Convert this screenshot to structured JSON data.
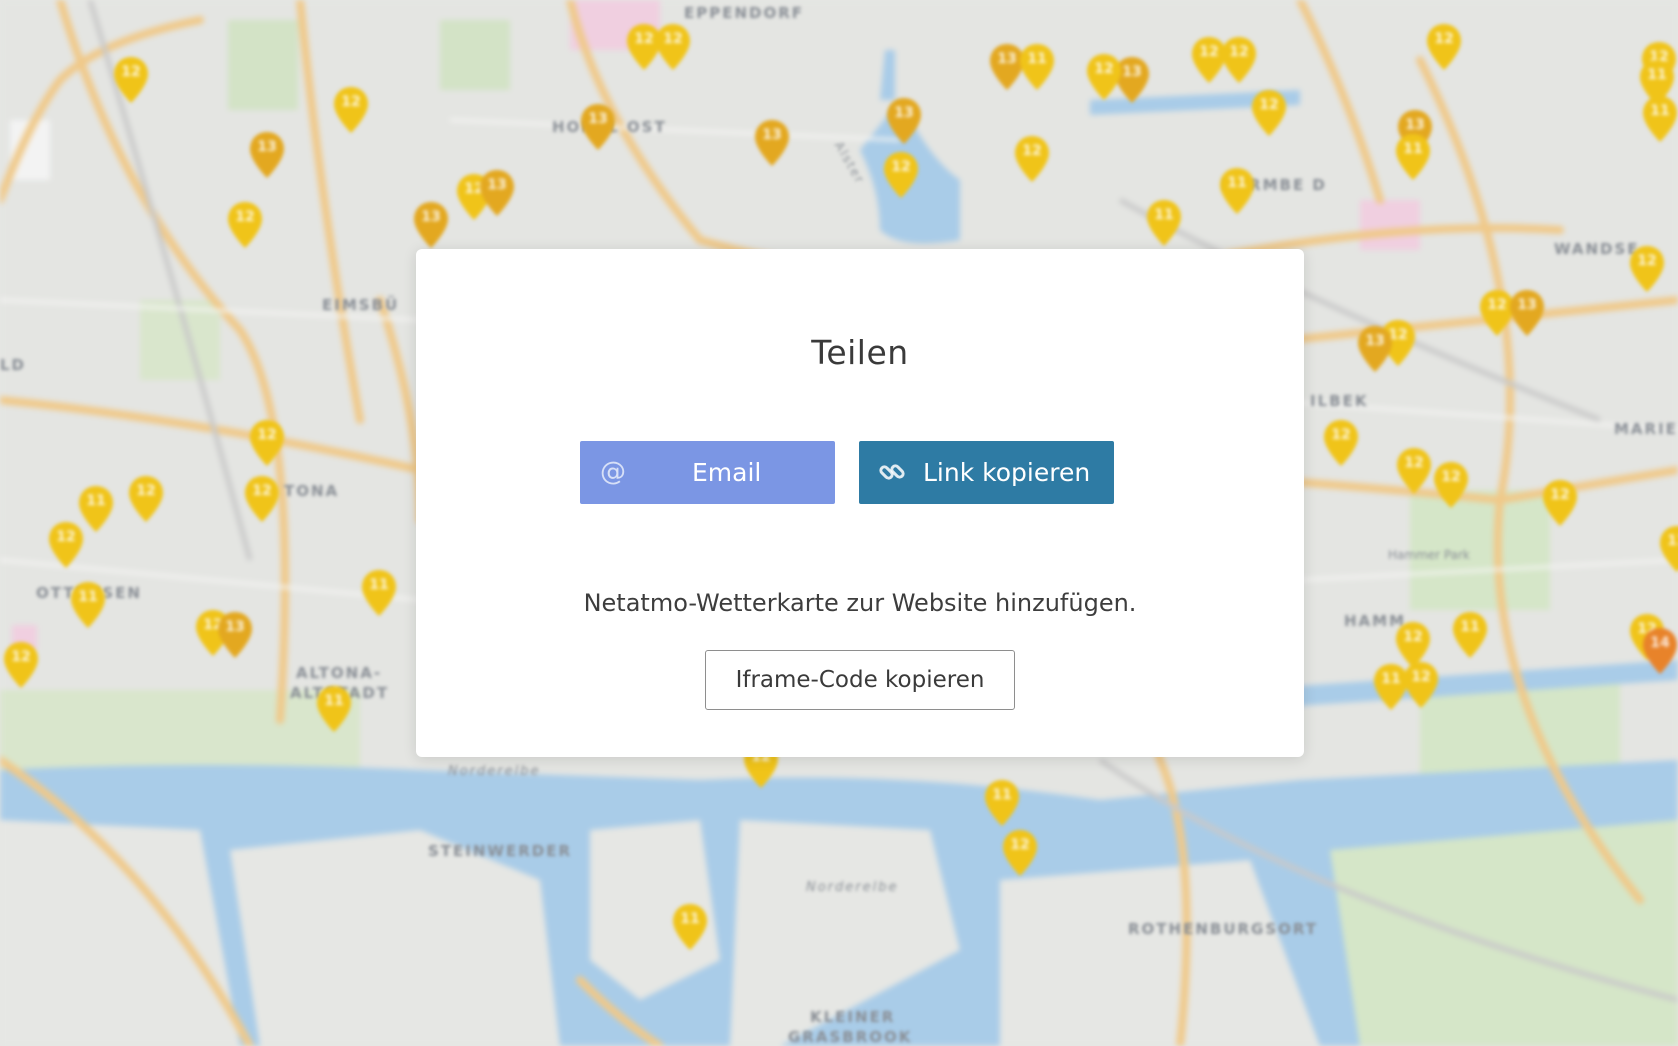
{
  "modal": {
    "title": "Teilen",
    "email_label": "Email",
    "link_label": "Link kopieren",
    "embed_text": "Netatmo-Wetterkarte zur Website hinzufügen.",
    "iframe_label": "Iframe-Code kopieren",
    "email_icon": "at-sign-icon",
    "link_icon": "chain-link-icon"
  },
  "colors": {
    "email_button": "#7b96e4",
    "link_button": "#2e7ba4",
    "pin_yellow": "#f0c419",
    "pin_amber": "#e3a820",
    "pin_orange": "#e8832a",
    "water": "#a9cce8"
  },
  "map": {
    "labels": {
      "eppendorf": "EPPENDORF",
      "hohel_ost": "HOHEL    OST",
      "eimsbuettel": "EIMSBÜ",
      "barmbek": "BARMBE       D",
      "wandsbek": "WANDSE",
      "eilbek": "ILBEK",
      "marienthal": "MARIE",
      "altona": "TONA",
      "ottensen": "OTTENSEN",
      "altona_altstadt_1": "ALTONA-",
      "altona_altstadt_2": "ALTSTADT",
      "hamm": "HAMM",
      "hammer_park": "Hammer Park",
      "norderelbe_1": "Norderelbe",
      "norderelbe_2": "Norderelbe",
      "steinwerder": "STEINWERDER",
      "rothenburgsort": "ROTHENBURGSORT",
      "kleiner_1": "KLEINER",
      "kleiner_2": "GRASBROOK",
      "alster": "Alster",
      "ld": "LD"
    },
    "pins": [
      {
        "v": "12",
        "c": "yellow"
      },
      {
        "v": "12",
        "c": "yellow"
      },
      {
        "v": "13",
        "c": "amber"
      },
      {
        "v": "12",
        "c": "yellow"
      },
      {
        "v": "12",
        "c": "yellow"
      },
      {
        "v": "12",
        "c": "yellow"
      },
      {
        "v": "13",
        "c": "amber"
      },
      {
        "v": "12",
        "c": "yellow"
      },
      {
        "v": "13",
        "c": "amber"
      },
      {
        "v": "13",
        "c": "amber"
      },
      {
        "v": "13",
        "c": "amber"
      },
      {
        "v": "12",
        "c": "yellow"
      },
      {
        "v": "12",
        "c": "yellow"
      },
      {
        "v": "13",
        "c": "amber"
      },
      {
        "v": "11",
        "c": "yellow"
      },
      {
        "v": "13",
        "c": "amber"
      },
      {
        "v": "12",
        "c": "yellow"
      },
      {
        "v": "12",
        "c": "yellow"
      },
      {
        "v": "12",
        "c": "yellow"
      },
      {
        "v": "12",
        "c": "yellow"
      },
      {
        "v": "11",
        "c": "yellow"
      },
      {
        "v": "11",
        "c": "yellow"
      },
      {
        "v": "13",
        "c": "amber"
      },
      {
        "v": "12",
        "c": "yellow"
      },
      {
        "v": "11",
        "c": "yellow"
      },
      {
        "v": "12",
        "c": "yellow"
      },
      {
        "v": "11",
        "c": "yellow"
      },
      {
        "v": "12",
        "c": "yellow"
      },
      {
        "v": "12",
        "c": "yellow"
      },
      {
        "v": "13",
        "c": "amber"
      },
      {
        "v": "12",
        "c": "yellow"
      },
      {
        "v": "13",
        "c": "amber"
      },
      {
        "v": "12",
        "c": "yellow"
      },
      {
        "v": "12",
        "c": "yellow"
      },
      {
        "v": "12",
        "c": "yellow"
      },
      {
        "v": "11",
        "c": "yellow"
      },
      {
        "v": "12",
        "c": "yellow"
      },
      {
        "v": "11",
        "c": "yellow"
      },
      {
        "v": "12",
        "c": "yellow"
      },
      {
        "v": "12",
        "c": "yellow"
      },
      {
        "v": "11",
        "c": "yellow"
      },
      {
        "v": "12",
        "c": "yellow"
      },
      {
        "v": "11",
        "c": "yellow"
      },
      {
        "v": "12",
        "c": "yellow"
      },
      {
        "v": "11",
        "c": "yellow"
      },
      {
        "v": "11",
        "c": "yellow"
      },
      {
        "v": "14",
        "c": "orange"
      },
      {
        "v": "13",
        "c": "amber"
      },
      {
        "v": "12",
        "c": "yellow"
      },
      {
        "v": "12",
        "c": "yellow"
      },
      {
        "v": "11",
        "c": "yellow"
      },
      {
        "v": "12",
        "c": "yellow"
      },
      {
        "v": "12",
        "c": "yellow"
      },
      {
        "v": "11",
        "c": "yellow"
      },
      {
        "v": "11",
        "c": "yellow"
      },
      {
        "v": "12",
        "c": "yellow"
      },
      {
        "v": "13",
        "c": "amber"
      },
      {
        "v": "12",
        "c": "yellow"
      },
      {
        "v": "11",
        "c": "yellow"
      },
      {
        "v": "12",
        "c": "yellow"
      }
    ]
  }
}
